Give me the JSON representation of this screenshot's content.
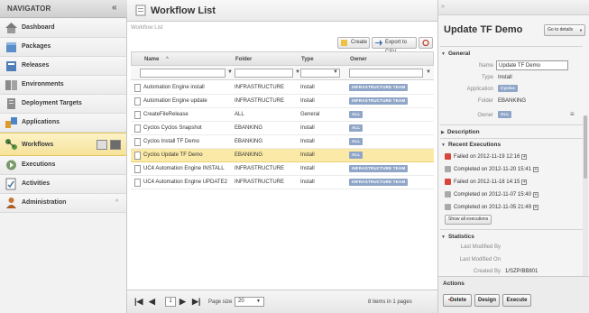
{
  "navigator": {
    "title": "NAVIGATOR",
    "collapse_glyph": "«",
    "items": [
      {
        "label": "Dashboard",
        "icon": "home-icon"
      },
      {
        "label": "Packages",
        "icon": "package-icon"
      },
      {
        "label": "Releases",
        "icon": "release-icon"
      },
      {
        "label": "Environments",
        "icon": "environment-icon"
      },
      {
        "label": "Deployment Targets",
        "icon": "server-icon"
      },
      {
        "label": "Applications",
        "icon": "application-icon"
      },
      {
        "label": "Workflows",
        "icon": "workflow-icon",
        "active": true
      },
      {
        "label": "Executions",
        "icon": "execution-icon"
      },
      {
        "label": "Activities",
        "icon": "activity-icon"
      },
      {
        "label": "Administration",
        "icon": "admin-icon"
      }
    ]
  },
  "main": {
    "title": "Workflow List",
    "breadcrumb": "Workflow List",
    "toolbar": {
      "create_label": "Create",
      "export_label": "Export to CSV"
    },
    "columns": [
      "Name",
      "Folder",
      "Type",
      "Owner"
    ],
    "rows": [
      {
        "name": "Automation Engine install",
        "folder": "INFRASTRUCTURE",
        "type": "Install",
        "owner": "INFRASTRUCTURE TEAM"
      },
      {
        "name": "Automation Engine update",
        "folder": "INFRASTRUCTURE",
        "type": "Install",
        "owner": "INFRASTRUCTURE TEAM"
      },
      {
        "name": "CreateFileRelease",
        "folder": "ALL",
        "type": "General",
        "owner": "ALL"
      },
      {
        "name": "Cyclos Cyclos Snapshot",
        "folder": "EBANKING",
        "type": "Install",
        "owner": "ALL"
      },
      {
        "name": "Cyclos Install TF Demo",
        "folder": "EBANKING",
        "type": "Install",
        "owner": "ALL"
      },
      {
        "name": "Cyclos Update TF Demo",
        "folder": "EBANKING",
        "type": "Install",
        "owner": "ALL",
        "selected": true
      },
      {
        "name": "UC4 Automation Engine INSTALL",
        "folder": "INFRASTRUCTURE",
        "type": "Install",
        "owner": "INFRASTRUCTURE TEAM"
      },
      {
        "name": "UC4 Automation Engine UPDATE2",
        "folder": "INFRASTRUCTURE",
        "type": "Install",
        "owner": "INFRASTRUCTURE TEAM"
      }
    ],
    "pager": {
      "page": "1",
      "page_size_label": "Page size",
      "page_size": "20",
      "info": "8 items in 1 pages"
    }
  },
  "detail": {
    "title": "Update TF Demo",
    "goto_label": "Go to details",
    "general_label": "General",
    "fields": [
      {
        "label": "Name",
        "value": "Update TF Demo"
      },
      {
        "label": "Type",
        "value": "Install"
      },
      {
        "label": "Application",
        "value": "Cyclos"
      },
      {
        "label": "Folder",
        "value": "EBANKING"
      },
      {
        "label": "Owner",
        "value": "ALL"
      }
    ],
    "description_label": "Description",
    "recent_label": "Recent Executions",
    "executions": [
      {
        "text": "Failed on 2012-11-19 12:16",
        "status": "failed"
      },
      {
        "text": "Completed on 2012-11-20 15:41",
        "status": "completed"
      },
      {
        "text": "Failed on 2012-11-18 14:15",
        "status": "failed"
      },
      {
        "text": "Completed on 2012-11-07 15:40",
        "status": "completed"
      },
      {
        "text": "Completed on 2012-11-05 21:49",
        "status": "completed"
      }
    ],
    "show_all_label": "Show all executions",
    "statistics_label": "Statistics",
    "stats": [
      {
        "label": "Last Modified By",
        "value": ""
      },
      {
        "label": "Last Modified On",
        "value": ""
      },
      {
        "label": "Created By",
        "value": "1/SZP/BB801"
      }
    ],
    "actions_label": "Actions",
    "delete_label": "Delete",
    "design_label": "Design",
    "execute_label": "Execute"
  },
  "colors": {
    "accent_selected": "#fbeaa7",
    "badge": "#8fa6c8",
    "failed": "#d9453b",
    "completed": "#a9a9a9"
  }
}
